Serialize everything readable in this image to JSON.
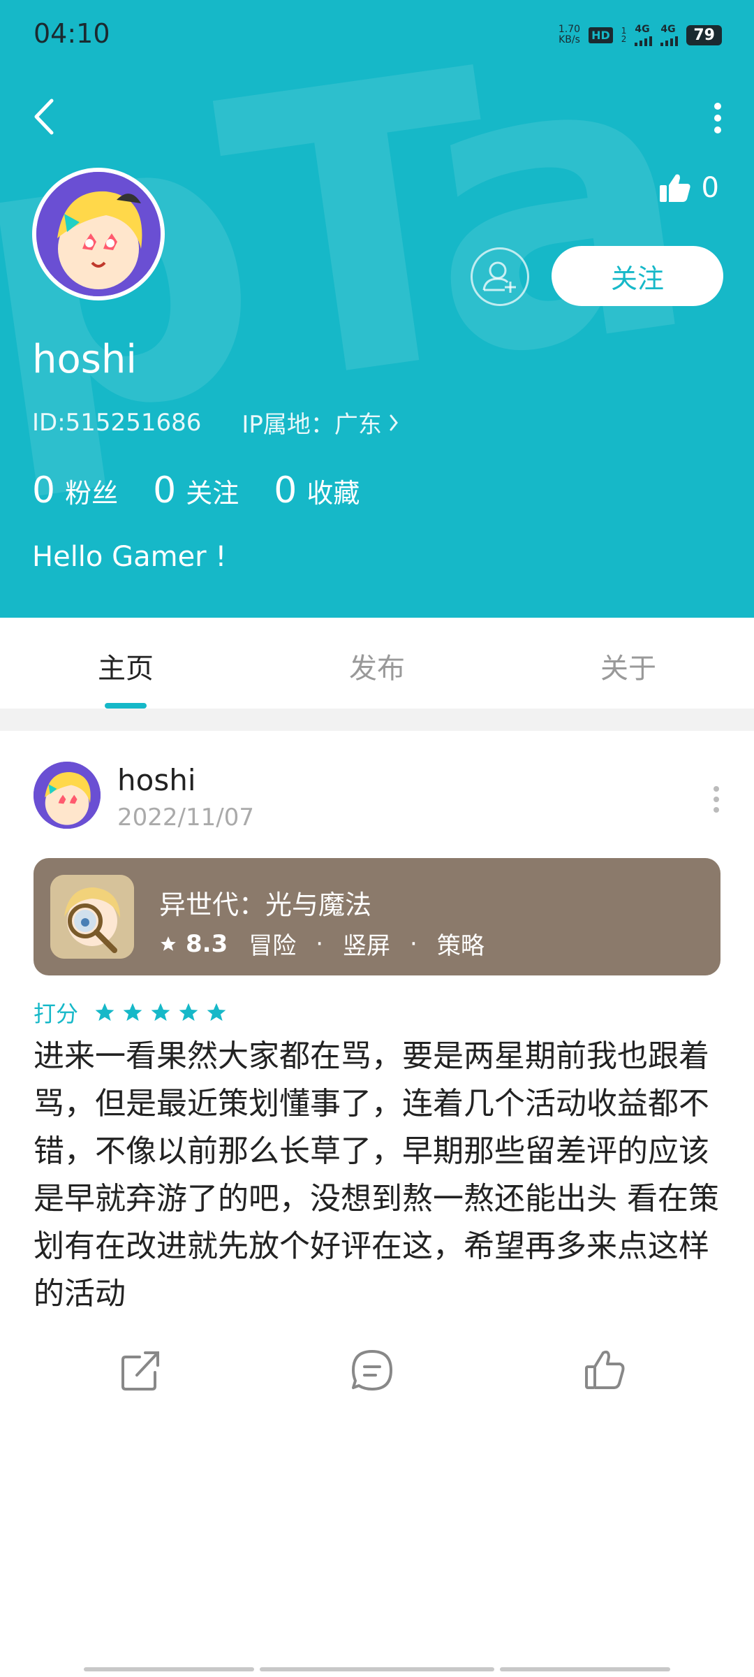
{
  "status_bar": {
    "time": "04:10",
    "net_speed_value": "1.70",
    "net_speed_unit": "KB/s",
    "hd": "HD",
    "hd_sub": "1",
    "hd_sub2": "2",
    "signal1": "4G",
    "signal2": "4G",
    "battery": "79"
  },
  "colors": {
    "accent": "#16b8c8",
    "game_card": "#8b7a6b"
  },
  "profile": {
    "likes_count": "0",
    "follow_label": "关注",
    "username": "hoshi",
    "id_text": "ID:515251686",
    "ip_text": "IP属地：广东",
    "stats": [
      {
        "num": "0",
        "label": "粉丝"
      },
      {
        "num": "0",
        "label": "关注"
      },
      {
        "num": "0",
        "label": "收藏"
      }
    ],
    "bio": "Hello Gamer !"
  },
  "tabs": [
    {
      "label": "主页",
      "active": true
    },
    {
      "label": "发布",
      "active": false
    },
    {
      "label": "关于",
      "active": false
    }
  ],
  "post": {
    "username": "hoshi",
    "date": "2022/11/07",
    "game": {
      "name": "异世代：光与魔法",
      "score": "8.3",
      "tags": [
        "冒险",
        "竖屏",
        "策略"
      ],
      "tag_separator": "·"
    },
    "rating_label": "打分",
    "rating_stars": 5,
    "review_text": "进来一看果然大家都在骂，要是两星期前我也跟着骂，但是最近策划懂事了，连着几个活动收益都不错，不像以前那么长草了，早期那些留差评的应该是早就弃游了的吧，没想到熬一熬还能出头 看在策划有在改进就先放个好评在这，希望再多来点这样的活动"
  },
  "icons": {
    "back": "back-arrow-icon",
    "more": "more-vertical-icon",
    "like": "thumbs-up-icon",
    "add_friend": "add-user-icon",
    "chevron": "chevron-right-icon",
    "star": "star-icon",
    "share": "share-icon",
    "comment": "comment-icon"
  }
}
